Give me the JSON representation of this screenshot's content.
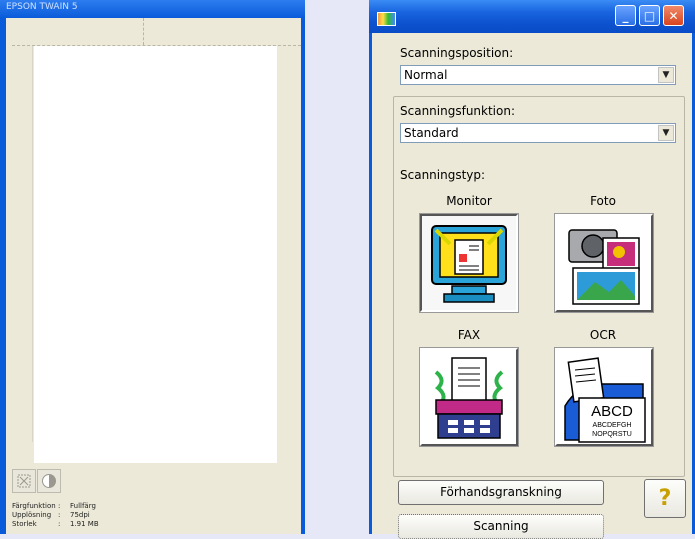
{
  "left": {
    "title": "EPSON TWAIN 5",
    "info": [
      {
        "key": "Färgfunktion",
        "sep": ":",
        "value": "Fullfärg"
      },
      {
        "key": "Upplösning",
        "sep": ":",
        "value": "75dpi"
      },
      {
        "key": "Storlek",
        "sep": ":",
        "value": "1.91 MB"
      }
    ]
  },
  "right": {
    "title_buttons": {
      "minimize": "_",
      "maximize": "□",
      "close": "✕"
    },
    "position_label": "Scanningsposition:",
    "position_value": "Normal",
    "function_label": "Scanningsfunktion:",
    "function_value": "Standard",
    "type_label": "Scanningstyp:",
    "types": [
      {
        "label": "Monitor",
        "icon": "monitor-icon"
      },
      {
        "label": "Foto",
        "icon": "camera-photo-icon"
      },
      {
        "label": "FAX",
        "icon": "fax-icon"
      },
      {
        "label": "OCR",
        "icon": "ocr-document-icon"
      }
    ],
    "preview_button": "Förhandsgranskning",
    "scan_button": "Scanning",
    "help_button": "?"
  },
  "colors": {
    "titlebar": "#0a5bd9",
    "window_bg": "#ece9d8",
    "desktop": "#e6e8f7"
  }
}
